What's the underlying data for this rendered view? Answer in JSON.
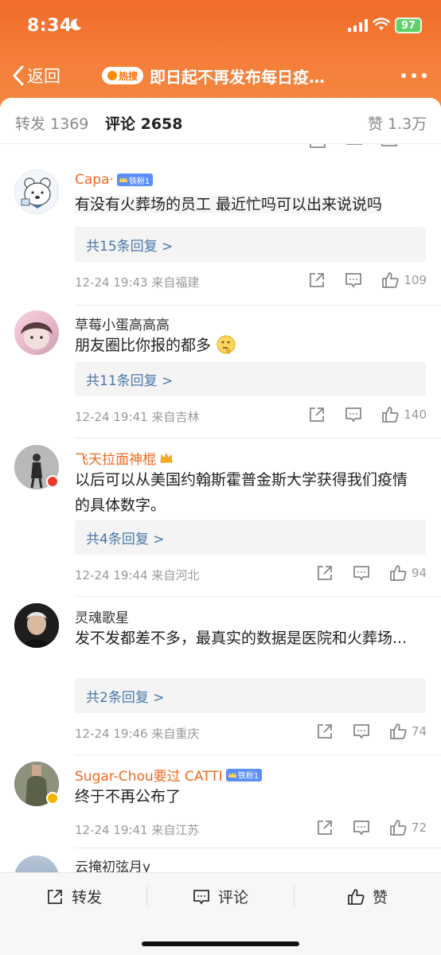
{
  "status": {
    "time": "8:34",
    "battery": "97"
  },
  "nav": {
    "back_label": "返回",
    "hot_badge": "热搜",
    "title": "即日起不再发布每日疫…"
  },
  "tabs": [
    {
      "label": "转发 1369"
    },
    {
      "label": "评论 2658"
    },
    {
      "label": "赞 1.3万"
    }
  ],
  "comments": [
    {
      "username": "Capa·",
      "badge": "铁粉1",
      "text": "有没有火葬场的员工 最近忙吗可以出来说说吗",
      "replies": "共15条回复 >",
      "meta": "12-24 19:43  来自福建",
      "likes": "109"
    },
    {
      "username": "草莓小蛋高高高",
      "badge": "",
      "text": "朋友圈比你报的都多",
      "emoji": "thinking-face",
      "replies": "共11条回复 >",
      "meta": "12-24 19:41  来自吉林",
      "likes": "140"
    },
    {
      "username": "飞天拉面神棍",
      "badge": "",
      "text": "以后可以从美国约翰斯霍普金斯大学获得我们疫情的具体数字。",
      "replies": "共4条回复 >",
      "meta": "12-24 19:44  来自河北",
      "likes": "94"
    },
    {
      "username": "灵魂歌星",
      "badge": "",
      "text": "发不发都差不多，最真实的数据是医院和火葬场...",
      "replies": "共2条回复 >",
      "meta": "12-24 19:46  来自重庆",
      "likes": "74"
    },
    {
      "username": "Sugar-Chou要过 CATTI",
      "badge": "铁粉1",
      "text": "终于不再公布了",
      "meta": "12-24 19:41  来自江苏",
      "likes": "72"
    },
    {
      "username": "云掩初弦月y"
    }
  ],
  "bottom": {
    "repost": "转发",
    "comment": "评论",
    "like": "赞"
  },
  "colors": {
    "accent": "#f26b2a",
    "link": "#4a78a8",
    "username_orange": "#f06a21"
  }
}
